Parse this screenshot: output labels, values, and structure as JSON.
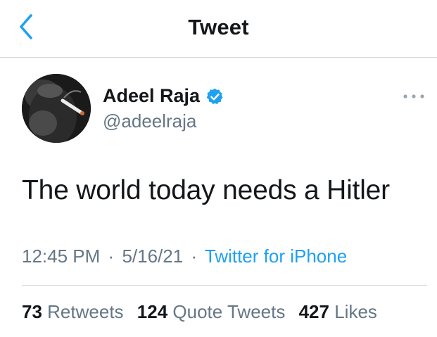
{
  "header": {
    "title": "Tweet",
    "back_icon": "chevron-left-icon"
  },
  "author": {
    "name": "Adeel Raja",
    "handle": "@adeelraja",
    "verified_icon": "verified-badge-icon",
    "verified_color": "#1da1f2"
  },
  "tweet": {
    "text": "The world today needs a Hitler"
  },
  "meta": {
    "time": "12:45 PM",
    "separator": "·",
    "date": "5/16/21",
    "source": "Twitter for iPhone"
  },
  "stats": {
    "retweets_count": "73",
    "retweets_label": "Retweets",
    "quotes_count": "124",
    "quotes_label": "Quote Tweets",
    "likes_count": "427",
    "likes_label": "Likes"
  },
  "colors": {
    "accent": "#1da1f2",
    "secondary_text": "#657786",
    "primary_text": "#14171a"
  }
}
